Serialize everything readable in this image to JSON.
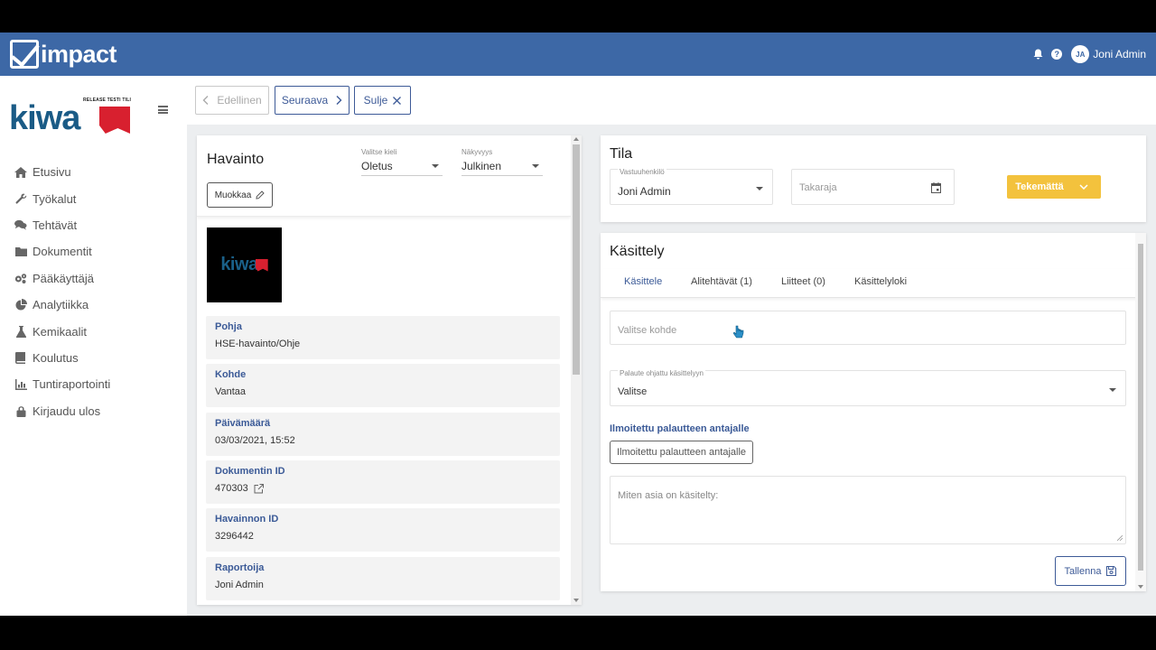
{
  "app": {
    "name": "impact",
    "brand": "kiwa",
    "brand_tag": "RELEASE TESTI TILI"
  },
  "topbar": {
    "avatar_initials": "JA",
    "user_name": "Joni Admin",
    "help_glyph": "?"
  },
  "icons": {
    "bell": "bell-icon",
    "help": "help-icon",
    "menu": "menu-icon",
    "chevron_left": "chevron-left-icon",
    "chevron_right": "chevron-right-icon",
    "close": "close-icon",
    "pencil": "pencil-icon",
    "external_link": "external-link-icon",
    "calendar": "calendar-icon",
    "save": "save-icon",
    "cursor": "cursor-icon"
  },
  "sidebar": {
    "items": [
      {
        "label": "Etusivu",
        "icon": "home-icon"
      },
      {
        "label": "Työkalut",
        "icon": "wrench-icon"
      },
      {
        "label": "Tehtävät",
        "icon": "comments-icon"
      },
      {
        "label": "Dokumentit",
        "icon": "folder-icon"
      },
      {
        "label": "Pääkäyttäjä",
        "icon": "cogs-icon"
      },
      {
        "label": "Analytiikka",
        "icon": "pie-chart-icon"
      },
      {
        "label": "Kemikaalit",
        "icon": "flask-icon"
      },
      {
        "label": "Koulutus",
        "icon": "book-icon"
      },
      {
        "label": "Tuntiraportointi",
        "icon": "bar-chart-icon"
      },
      {
        "label": "Kirjaudu ulos",
        "icon": "lock-icon"
      }
    ]
  },
  "toolbar": {
    "prev_label": "Edellinen",
    "next_label": "Seuraava",
    "close_label": "Sulje"
  },
  "observation": {
    "title": "Havainto",
    "language": {
      "label": "Valitse kieli",
      "value": "Oletus"
    },
    "visibility": {
      "label": "Näkyvyys",
      "value": "Julkinen"
    },
    "edit_label": "Muokkaa",
    "fields": [
      {
        "label": "Pohja",
        "value": "HSE-havainto/Ohje"
      },
      {
        "label": "Kohde",
        "value": "Vantaa"
      },
      {
        "label": "Päivämäärä",
        "value": "03/03/2021, 15:52"
      },
      {
        "label": "Dokumentin ID",
        "value": "470303"
      },
      {
        "label": "Havainnon ID",
        "value": "3296442"
      },
      {
        "label": "Raportoija",
        "value": "Joni Admin"
      }
    ]
  },
  "status": {
    "title": "Tila",
    "responsible": {
      "label": "Vastuuhenkilö",
      "value": "Joni Admin"
    },
    "deadline_placeholder": "Takaraja",
    "state_label": "Tekemättä",
    "state_color": "#f3c23d"
  },
  "handling": {
    "title": "Käsittely",
    "tabs": [
      "Käsittele",
      "Alitehtävät (1)",
      "Liitteet (0)",
      "Käsittelyloki"
    ],
    "active_tab": 0,
    "target_placeholder": "Valitse kohde",
    "feedback": {
      "label": "Palaute ohjattu käsittelyyn",
      "value": "Valitse"
    },
    "notified_heading": "Ilmoitettu palautteen antajalle",
    "notified_button": "Ilmoitettu palautteen antajalle",
    "comment_placeholder": "Miten asia on käsitelty:",
    "save_label": "Tallenna"
  },
  "colors": {
    "topbar": "#3d68a6",
    "accent": "#3b5a97",
    "brand_blue": "#1a5b86",
    "brand_red": "#d8202f"
  }
}
